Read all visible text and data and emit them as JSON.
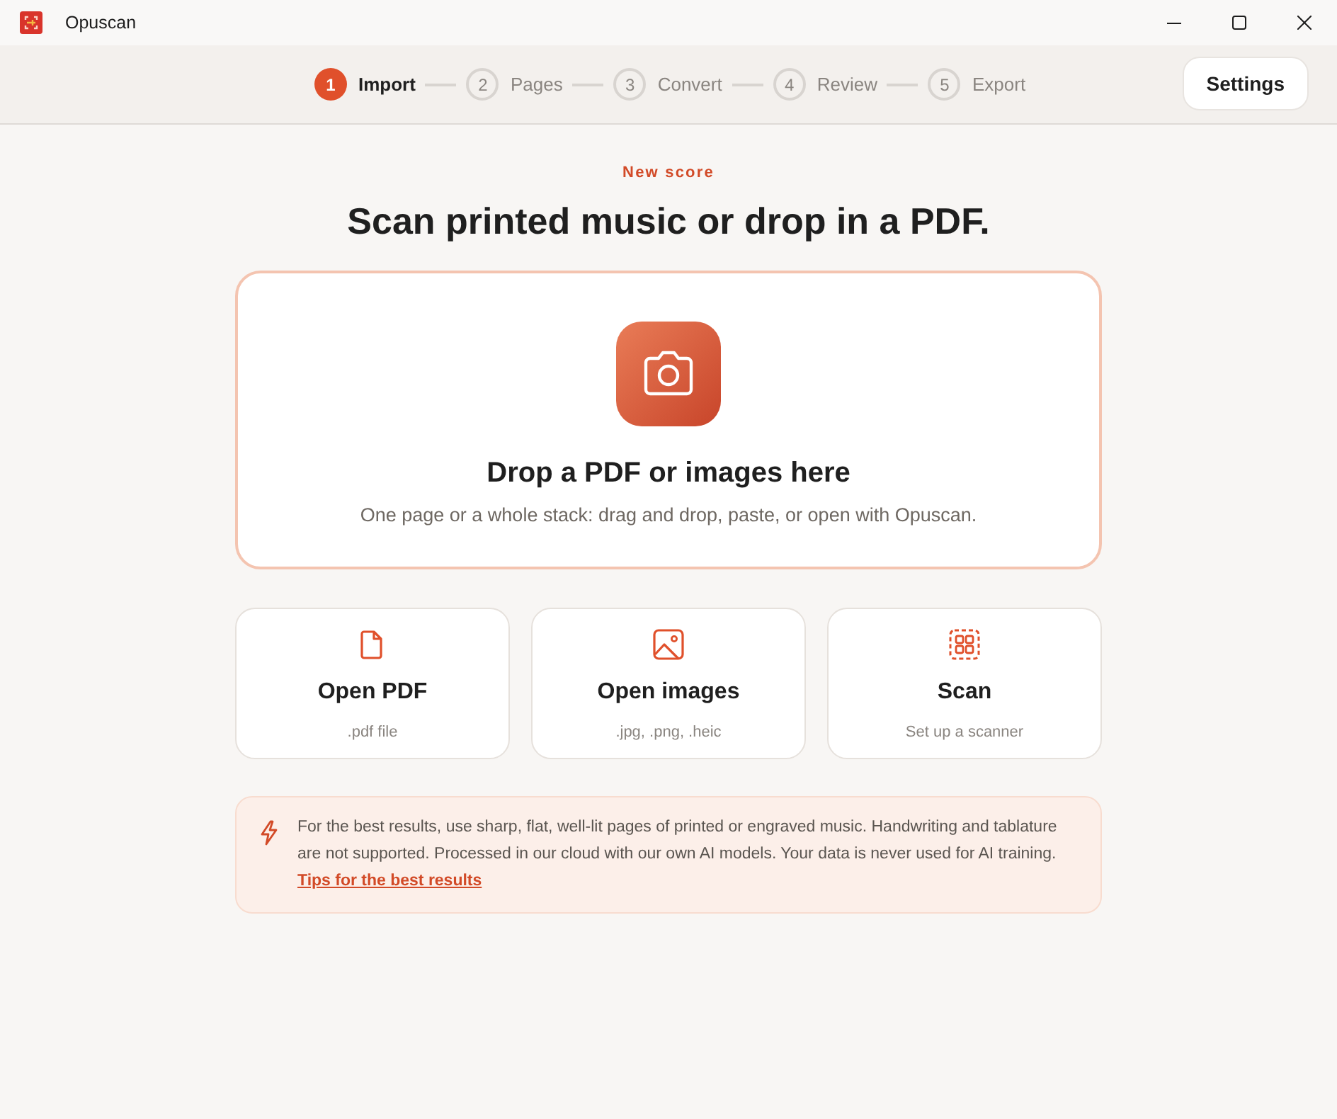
{
  "window": {
    "title": "Opuscan"
  },
  "steps": [
    {
      "number": "1",
      "label": "Import",
      "selected": true
    },
    {
      "number": "2",
      "label": "Pages",
      "selected": false
    },
    {
      "number": "3",
      "label": "Convert",
      "selected": false
    },
    {
      "number": "4",
      "label": "Review",
      "selected": false
    },
    {
      "number": "5",
      "label": "Export",
      "selected": false
    }
  ],
  "settings_button": {
    "label": "Settings"
  },
  "header": {
    "eyebrow": "New score",
    "title": "Scan printed music or drop in a PDF."
  },
  "dropzone": {
    "title": "Drop a PDF or images here",
    "subtitle": "One page or a whole stack: drag and drop, paste, or open with Opuscan."
  },
  "options": [
    {
      "kind": "pdf",
      "title": "Open PDF",
      "subtitle": ".pdf file"
    },
    {
      "kind": "images",
      "title": "Open images",
      "subtitle": ".jpg, .png, .heic"
    },
    {
      "kind": "scan",
      "title": "Scan",
      "subtitle": "Set up a scanner"
    }
  ],
  "notice": {
    "text": "For the best results, use sharp, flat, well-lit pages of printed or engraved music. Handwriting and tablature are not supported. Processed in our cloud with our own AI models. Your data is never used for AI training.",
    "link": "Tips for the best results"
  }
}
